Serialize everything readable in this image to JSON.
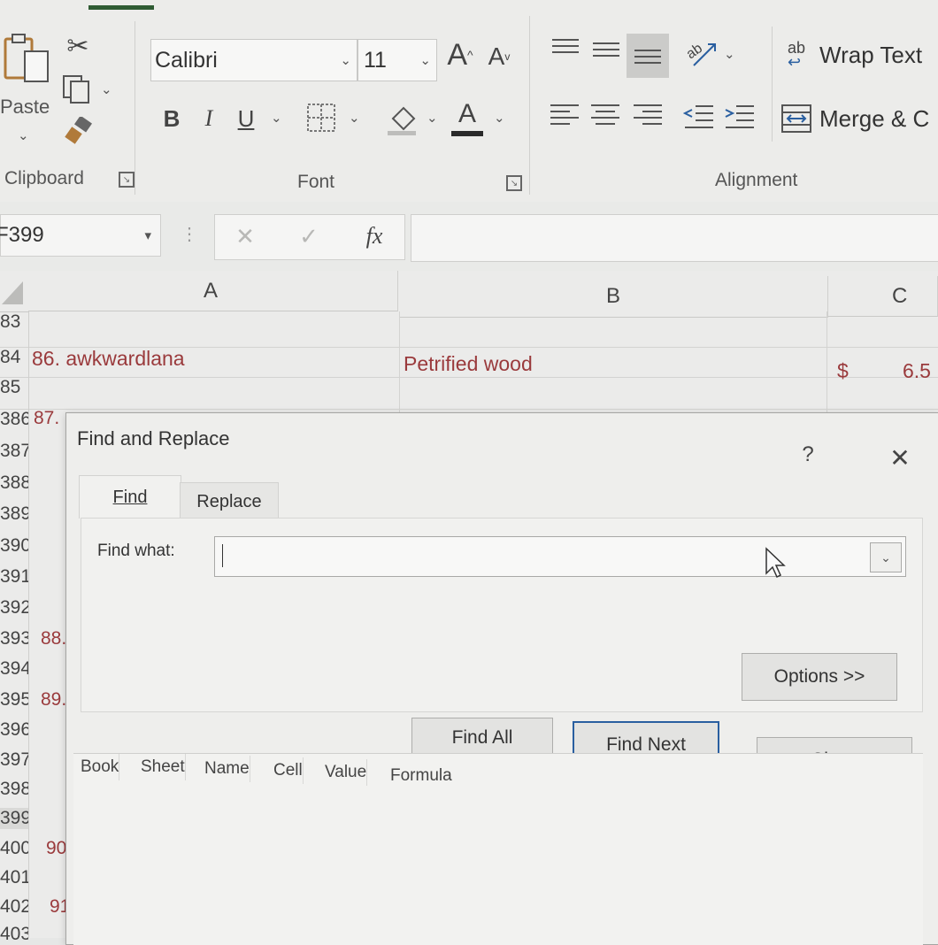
{
  "ribbon": {
    "clipboard": {
      "paste_label": "Paste",
      "group_label": "Clipboard"
    },
    "font": {
      "font_name": "Calibri",
      "font_size": "11",
      "group_label": "Font",
      "bold": "B",
      "italic": "I",
      "underline": "U",
      "font_color_letter": "A",
      "grow_letter": "A",
      "shrink_letter": "A"
    },
    "alignment": {
      "wrap_text_label": "Wrap Text",
      "merge_label": "Merge & C",
      "group_label": "Alignment",
      "wrap_glyph": "ab"
    }
  },
  "formula_bar": {
    "name_box": "F399",
    "fx_label": "fx",
    "cancel_glyph": "✕",
    "enter_glyph": "✓",
    "formula_value": ""
  },
  "sheet": {
    "columns": [
      "A",
      "B",
      "C"
    ],
    "rows": [
      "83",
      "84",
      "85",
      "386",
      "387",
      "388",
      "389",
      "390",
      "391",
      "392",
      "393",
      "394",
      "395",
      "396",
      "397",
      "398",
      "399",
      "400",
      "401",
      "402",
      "403"
    ],
    "cells": {
      "a84": "86. awkwardlana",
      "b84": "Petrified wood",
      "c84_currency": "$",
      "c84_value": "6.5",
      "a386": "87.",
      "a393": "88.",
      "a395": "89.",
      "a400": "90.",
      "a402": "91."
    }
  },
  "dialog": {
    "title": "Find and Replace",
    "help": "?",
    "close_glyph": "✕",
    "tabs": [
      "Find",
      "Replace"
    ],
    "find_what_label": "Find what:",
    "find_what_value": "",
    "options_button": "Options >>",
    "find_all_button": "Find All",
    "find_next_button": "Find Next",
    "close_button": "Close",
    "result_columns": [
      "Book",
      "Sheet",
      "Name",
      "Cell",
      "Value",
      "Formula"
    ]
  },
  "colors": {
    "cell_text": "#9a3a3c",
    "accent_green": "#2f5b33",
    "focus_blue": "#2a5fa0"
  }
}
